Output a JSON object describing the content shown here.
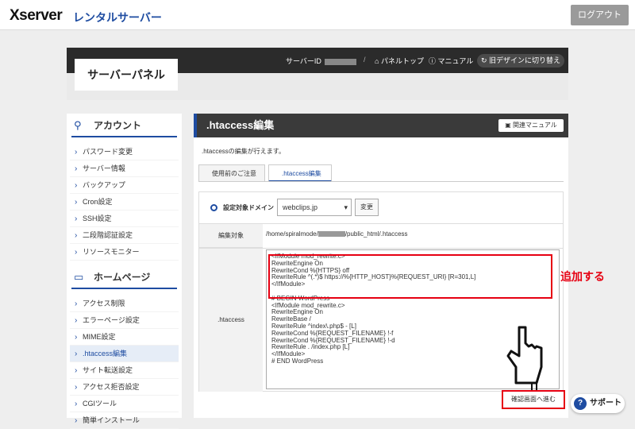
{
  "header": {
    "logo": "Xserver",
    "logo_sub": "レンタルサーバー",
    "logout": "ログアウト"
  },
  "panel": {
    "title": "サーバーパネル",
    "server_id_label": "サーバーID",
    "panel_top": "パネルトップ",
    "manual": "マニュアル",
    "old_design": "旧デザインに切り替え"
  },
  "sidebar": {
    "account_title": "アカウント",
    "account_items": [
      "パスワード変更",
      "サーバー情報",
      "バックアップ",
      "Cron設定",
      "SSH設定",
      "二段階認証設定",
      "リソースモニター"
    ],
    "homepage_title": "ホームページ",
    "homepage_items": [
      "アクセス制限",
      "エラーページ設定",
      "MIME設定",
      ".htaccess編集",
      "サイト転送設定",
      "アクセス拒否設定",
      "CGIツール",
      "簡単インストール"
    ]
  },
  "main": {
    "title": ".htaccess編集",
    "manual_btn": "関連マニュアル",
    "description": ".htaccessの編集が行えます。",
    "tabs": [
      "使用前のご注意",
      ".htaccess編集"
    ],
    "domain_label": "設定対象ドメイン",
    "domain_value": "webclips.jp",
    "change_btn": "変更",
    "target_label": "編集対象",
    "target_path_pre": "/home/spiralmode/",
    "target_path_post": "/public_html/.htaccess",
    "htaccess_label": ".htaccess",
    "content": "<IfModule mod_rewrite.c>\nRewriteEngine On\nRewriteCond %{HTTPS} off\nRewriteRule ^(.*)$ https://%{HTTP_HOST}%{REQUEST_URI} [R=301,L]\n</IfModule>\n\n# BEGIN WordPress\n<IfModule mod_rewrite.c>\nRewriteEngine On\nRewriteBase /\nRewriteRule ^index\\.php$ - [L]\nRewriteCond %{REQUEST_FILENAME} !-f\nRewriteCond %{REQUEST_FILENAME} !-d\nRewriteRule . /index.php [L]\n</IfModule>\n# END WordPress",
    "confirm_btn": "確認画面へ進む"
  },
  "annotation": {
    "callout": "追加する",
    "color": "#e60012"
  },
  "support": {
    "label": "サポート"
  }
}
